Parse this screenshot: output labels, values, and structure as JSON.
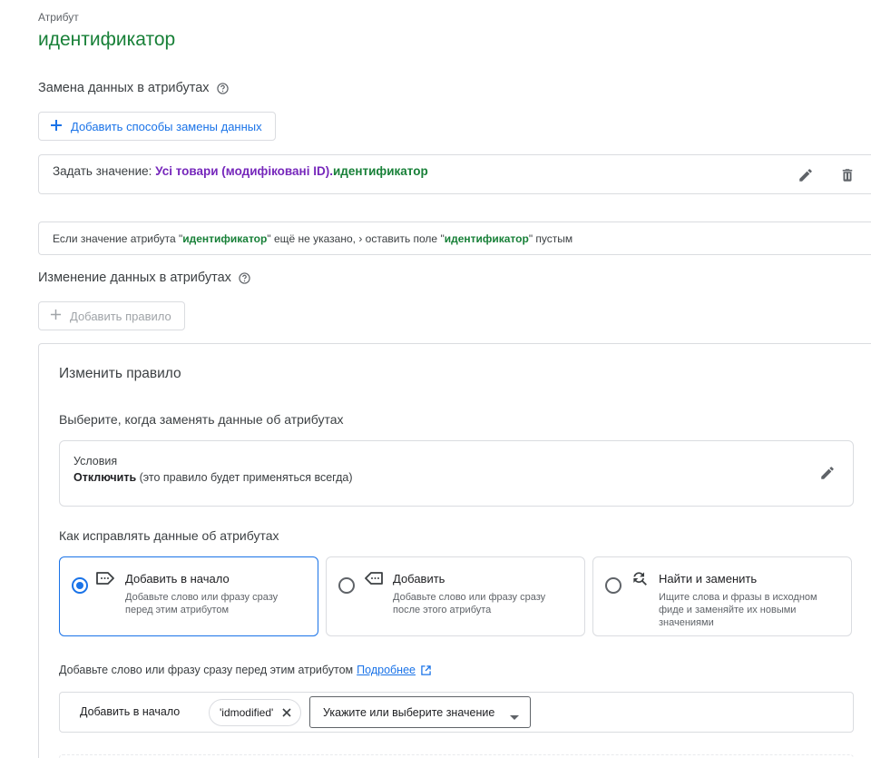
{
  "attribute": {
    "label": "Атрибут",
    "name": "идентификатор"
  },
  "replacement": {
    "title": "Замена данных в атрибутах",
    "add_button": "Добавить способы замены данных",
    "set_value_prefix": "Задать значение:",
    "set_value_source": "Усі товари (модифіковані ID).",
    "set_value_attr": "идентификатор",
    "fallback": {
      "p1": "Если значение атрибута \"",
      "attr1": "идентификатор",
      "p2": "\" ещё не указано, › оставить поле \"",
      "attr2": "идентификатор",
      "p3": "\" пустым"
    }
  },
  "modification": {
    "title": "Изменение данных в атрибутах",
    "add_rule": "Добавить правило"
  },
  "edit_rule": {
    "title": "Изменить правило",
    "when_title": "Выберите, когда заменять данные об атрибутах",
    "conditions_label": "Условия",
    "conditions_value": "Отключить",
    "conditions_note": " (это правило будет применяться всегда)",
    "how_title": "Как исправлять данные об атрибутах",
    "options": [
      {
        "title": "Добавить в начало",
        "desc": "Добавьте слово или фразу сразу перед этим атрибутом",
        "selected": true
      },
      {
        "title": "Добавить",
        "desc": "Добавьте слово или фразу сразу после этого атрибута",
        "selected": false
      },
      {
        "title": "Найти и заменить",
        "desc": "Ищите слова и фразы в исходном фиде и заменяйте их новыми значениями",
        "selected": false
      }
    ],
    "hint": "Добавьте слово или фразу сразу перед этим атрибутом",
    "learn_more": "Подробнее",
    "prepend_label": "Добавить в начало",
    "chip_value": "'idmodified'",
    "select_placeholder": "Укажите или выберите значение"
  },
  "colors": {
    "accent": "#1a73e8",
    "attr_green": "#188038",
    "source_purple": "#7627bb"
  }
}
